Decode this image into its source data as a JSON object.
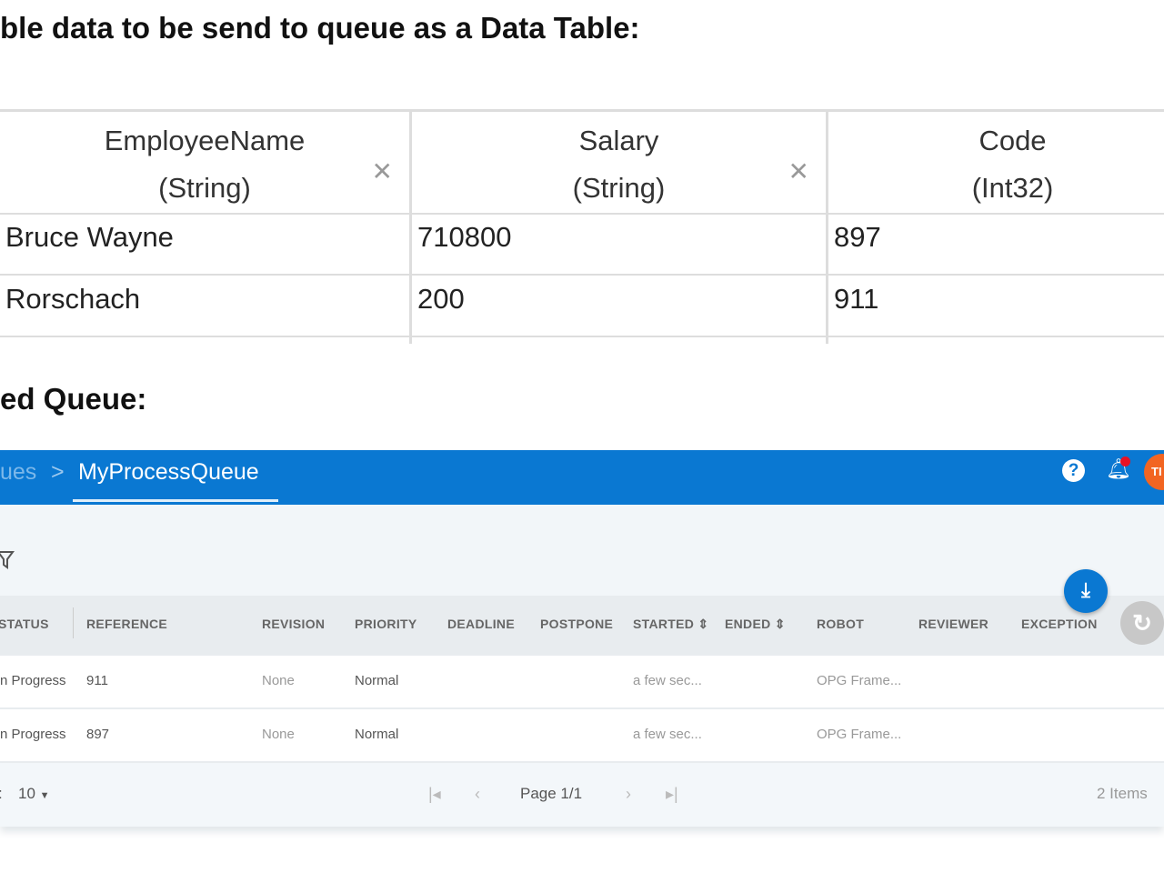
{
  "doc": {
    "heading1": "ble data to be send to queue as a Data Table:",
    "heading2": "ed Queue:"
  },
  "data_table": {
    "columns": [
      {
        "name": "EmployeeName",
        "type": "(String)"
      },
      {
        "name": "Salary",
        "type": "(String)"
      },
      {
        "name": "Code",
        "type": "(Int32)"
      }
    ],
    "rows": [
      [
        "Bruce Wayne",
        "710800",
        "897"
      ],
      [
        "Rorschach",
        "200",
        "911"
      ]
    ]
  },
  "app": {
    "colors": {
      "accent": "#0a78d2",
      "avatar": "#f26522"
    },
    "breadcrumb": {
      "parent": "ues",
      "separator": ">",
      "current": "MyProcessQueue"
    },
    "avatar": "TI",
    "table": {
      "headers": [
        "STATUS",
        "REFERENCE",
        "REVISION",
        "PRIORITY",
        "DEADLINE",
        "POSTPONE",
        "STARTED ⇕",
        "ENDED ⇕",
        "ROBOT",
        "REVIEWER",
        "EXCEPTION"
      ],
      "rows": [
        {
          "status": "n Progress",
          "reference": "911",
          "revision": "None",
          "priority": "Normal",
          "started": "a few sec...",
          "robot": "OPG Frame..."
        },
        {
          "status": "n Progress",
          "reference": "897",
          "revision": "None",
          "priority": "Normal",
          "started": "a few sec...",
          "robot": "OPG Frame..."
        }
      ]
    },
    "footer": {
      "page_size_label": ":",
      "page_size": "10",
      "page": "Page 1/1",
      "items": "2 Items"
    }
  }
}
